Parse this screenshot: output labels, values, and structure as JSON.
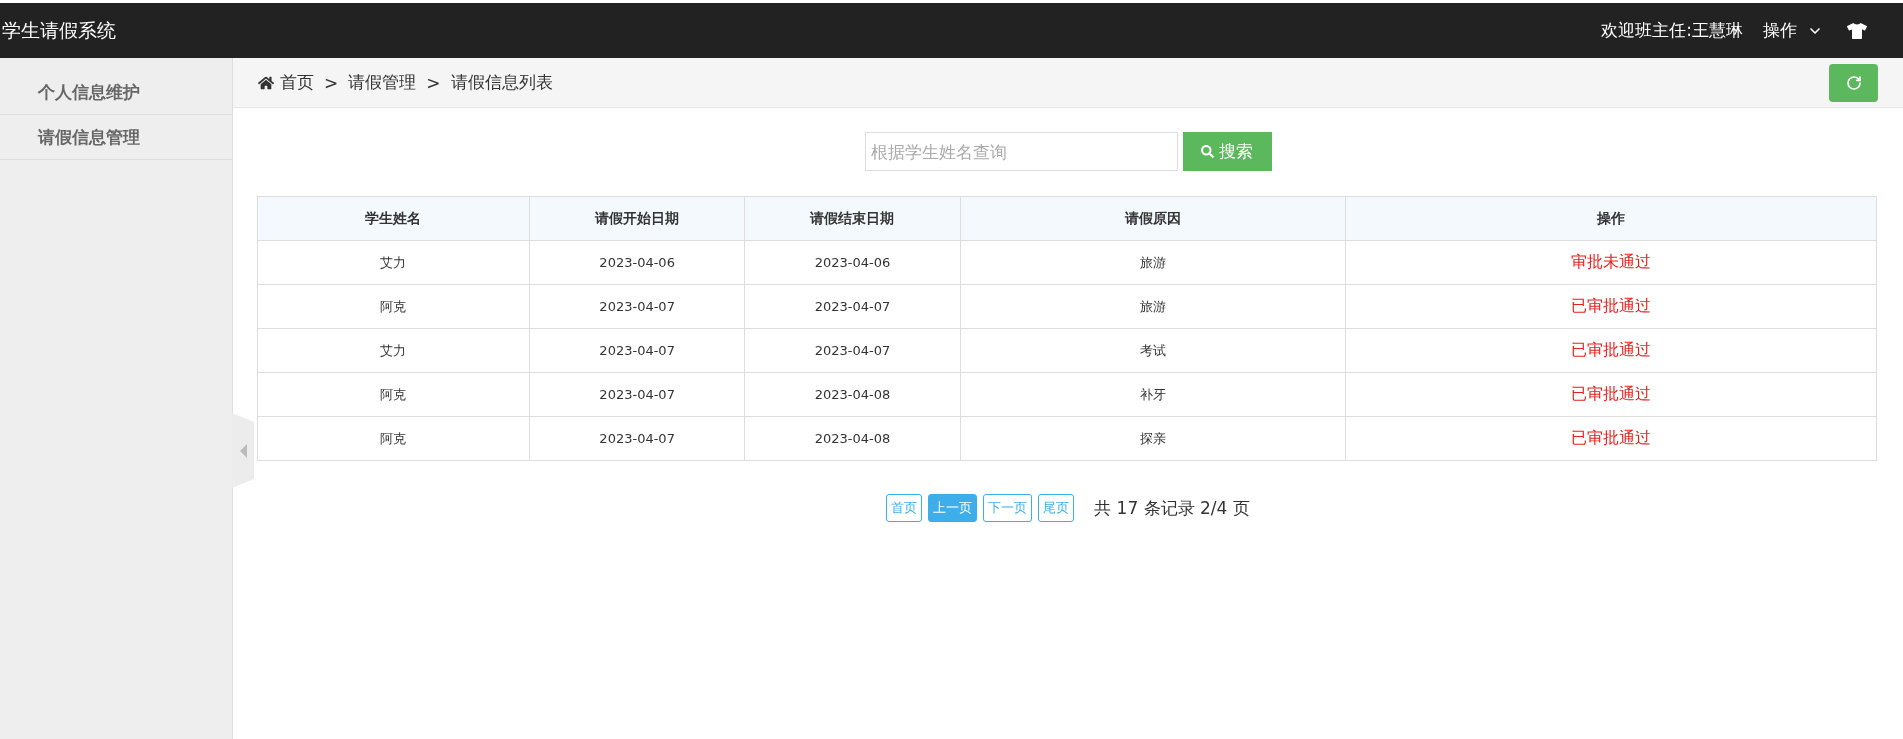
{
  "header": {
    "title": "学生请假系统",
    "welcome": "欢迎班主任:王慧琳",
    "menu": "操作"
  },
  "sidebar": {
    "items": [
      {
        "label": "个人信息维护",
        "selected": false
      },
      {
        "label": "请假信息管理",
        "selected": false
      }
    ]
  },
  "breadcrumb": [
    {
      "kind": "home",
      "label": "首页"
    },
    {
      "kind": "separator",
      "label": ">"
    },
    {
      "kind": "link",
      "label": "请假管理"
    },
    {
      "kind": "separator",
      "label": ">"
    },
    {
      "kind": "link",
      "label": "请假信息列表"
    }
  ],
  "search": {
    "placeholder": "根据学生姓名查询",
    "button": "搜索"
  },
  "table": {
    "columns": [
      "学生姓名",
      "请假开始日期",
      "请假结束日期",
      "请假原因",
      "操作"
    ],
    "rows": [
      [
        "艾力",
        "2023-04-06",
        "2023-04-06",
        "旅游",
        "审批未通过"
      ],
      [
        "阿克",
        "2023-04-07",
        "2023-04-07",
        "旅游",
        "已审批通过"
      ],
      [
        "艾力",
        "2023-04-07",
        "2023-04-07",
        "考试",
        "已审批通过"
      ],
      [
        "阿克",
        "2023-04-07",
        "2023-04-08",
        "补牙",
        "已审批通过"
      ],
      [
        "阿克",
        "2023-04-07",
        "2023-04-08",
        "探亲",
        "已审批通过"
      ]
    ]
  },
  "pagination": {
    "buttons": [
      {
        "label": "首页",
        "selected": false
      },
      {
        "label": "上一页",
        "selected": true
      },
      {
        "label": "下一页",
        "selected": false
      },
      {
        "label": "尾页",
        "selected": false
      }
    ],
    "summary": "共 17 条记录 2/4 页"
  }
}
